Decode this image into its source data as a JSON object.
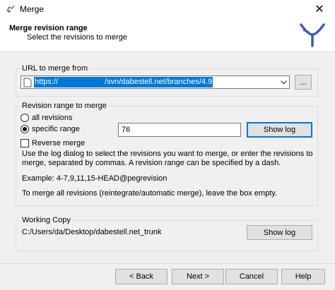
{
  "window": {
    "title": "Merge",
    "close_glyph": "✕"
  },
  "header": {
    "title": "Merge revision range",
    "subtitle": "Select the revisions to merge"
  },
  "url_group": {
    "label": "URL to merge from",
    "url_prefix": "https://",
    "url_suffix": "/svn/dabestell.net/branches/4.9",
    "browse_label": "..."
  },
  "range_group": {
    "label": "Revision range to merge",
    "all_revisions_label": "all revisions",
    "specific_range_label": "specific range",
    "selected": "specific_range",
    "range_value": "76",
    "show_log_label": "Show log",
    "reverse_merge_label": "Reverse merge",
    "reverse_merge_checked": false,
    "help_line1": "Use the log dialog to select the revisions you want to merge, or enter the revisions to",
    "help_line2": "merge, separated by commas. A revision range can be specified by a dash.",
    "example": "Example: 4-7,9,11,15-HEAD@pegrevision",
    "empty_note": "To merge all revisions (reintegrate/automatic merge), leave the box empty."
  },
  "working_copy": {
    "label": "Working Copy",
    "path": "C:/Users/da/Desktop/dabestell.net_trunk",
    "show_log_label": "Show log"
  },
  "footer": {
    "back_label": "< Back",
    "next_label": "Next >",
    "cancel_label": "Cancel",
    "help_label": "Help"
  },
  "colors": {
    "selection": "#0078d7",
    "logo": "#3d5ab8"
  }
}
